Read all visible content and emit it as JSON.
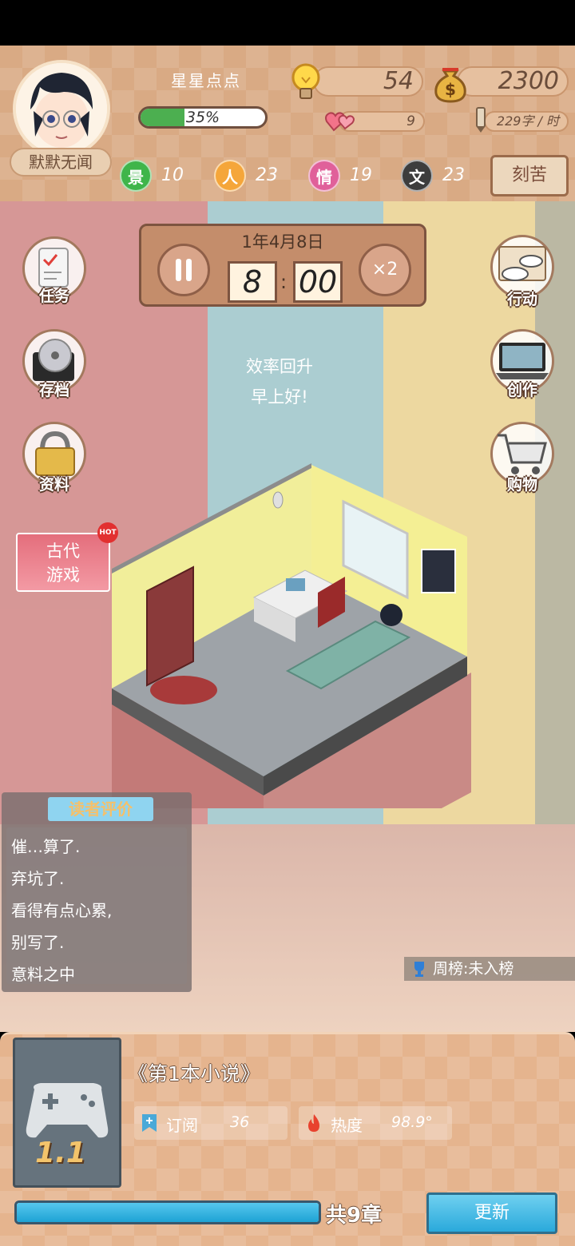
{
  "player": {
    "title": "星星点点",
    "name": "默默无闻",
    "xp_percent": 35,
    "xp_label": "35%"
  },
  "resources": {
    "ideas": "54",
    "money": "2300",
    "fans": "9",
    "speed": "229字 / 时"
  },
  "stats": [
    {
      "glyph": "景",
      "value": "10",
      "color": "#3fb54a"
    },
    {
      "glyph": "人",
      "value": "23",
      "color": "#f5a63a"
    },
    {
      "glyph": "情",
      "value": "19",
      "color": "#e0609a"
    },
    {
      "glyph": "文",
      "value": "23",
      "color": "#3d3d3d"
    }
  ],
  "effort_label": "刻苦",
  "clock": {
    "date": "1年4月8日",
    "hour": "8",
    "separator": ":",
    "minute": "00",
    "speed_label": "×2"
  },
  "left_menu": {
    "tasks": "任务",
    "save": "存档",
    "profile": "资料"
  },
  "right_menu": {
    "action": "行动",
    "create": "创作",
    "shop": "购物"
  },
  "promo": {
    "label_line1": "古代",
    "label_line2": "游戏",
    "badge": "HOT"
  },
  "status_messages": [
    "效率回升",
    "早上好!"
  ],
  "reviews": {
    "title": "读者评价",
    "lines": [
      "催…算了.",
      "弃坑了.",
      "看得有点心累,",
      "别写了.",
      "意料之中"
    ]
  },
  "weekly_rank": "周榜:未入榜",
  "novel": {
    "title": "《第1本小说》",
    "level": "1.1",
    "subscribe_label": "订阅",
    "subscribe_value": "36",
    "heat_label": "热度",
    "heat_value": "98.9°",
    "chapters_label": "共9章",
    "progress_percent": 100,
    "update_label": "更新"
  },
  "colors": {
    "header_bg": "#d9aa84",
    "accent_blue": "#2aa9db",
    "xp_green": "#4caf50"
  }
}
